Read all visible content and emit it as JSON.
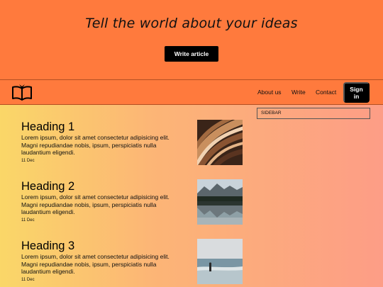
{
  "hero": {
    "title": "Tell the world about your ideas",
    "cta_label": "Write article"
  },
  "nav": {
    "logo_icon": "open-book-icon",
    "links": [
      {
        "label": "About us"
      },
      {
        "label": "Write"
      },
      {
        "label": "Contact"
      }
    ],
    "signin_label": "Sign in"
  },
  "sidebar": {
    "label": "SIDEBAR"
  },
  "articles": [
    {
      "heading": "Heading 1",
      "body": "Lorem ipsum, dolor sit amet consectetur adipisicing elit. Magni repudiandae nobis, ipsum, perspiciatis nulla laudantium eligendi.",
      "date": "11 Dec",
      "image": "abstract-swirl-photo"
    },
    {
      "heading": "Heading 2",
      "body": "Lorem ipsum, dolor sit amet consectetur adipisicing elit. Magni repudiandae nobis, ipsum, perspiciatis nulla laudantium eligendi.",
      "date": "11 Dec",
      "image": "mountain-lake-photo"
    },
    {
      "heading": "Heading 3",
      "body": "Lorem ipsum, dolor sit amet consectetur adipisicing elit. Magni repudiandae nobis, ipsum, perspiciatis nulla laudantium eligendi.",
      "date": "11 Dec",
      "image": "person-on-beach-photo"
    }
  ],
  "colors": {
    "header_bg": "#ff7a3d",
    "button_bg": "#000000",
    "gradient_start": "#fad768",
    "gradient_end": "#fd9d86"
  }
}
